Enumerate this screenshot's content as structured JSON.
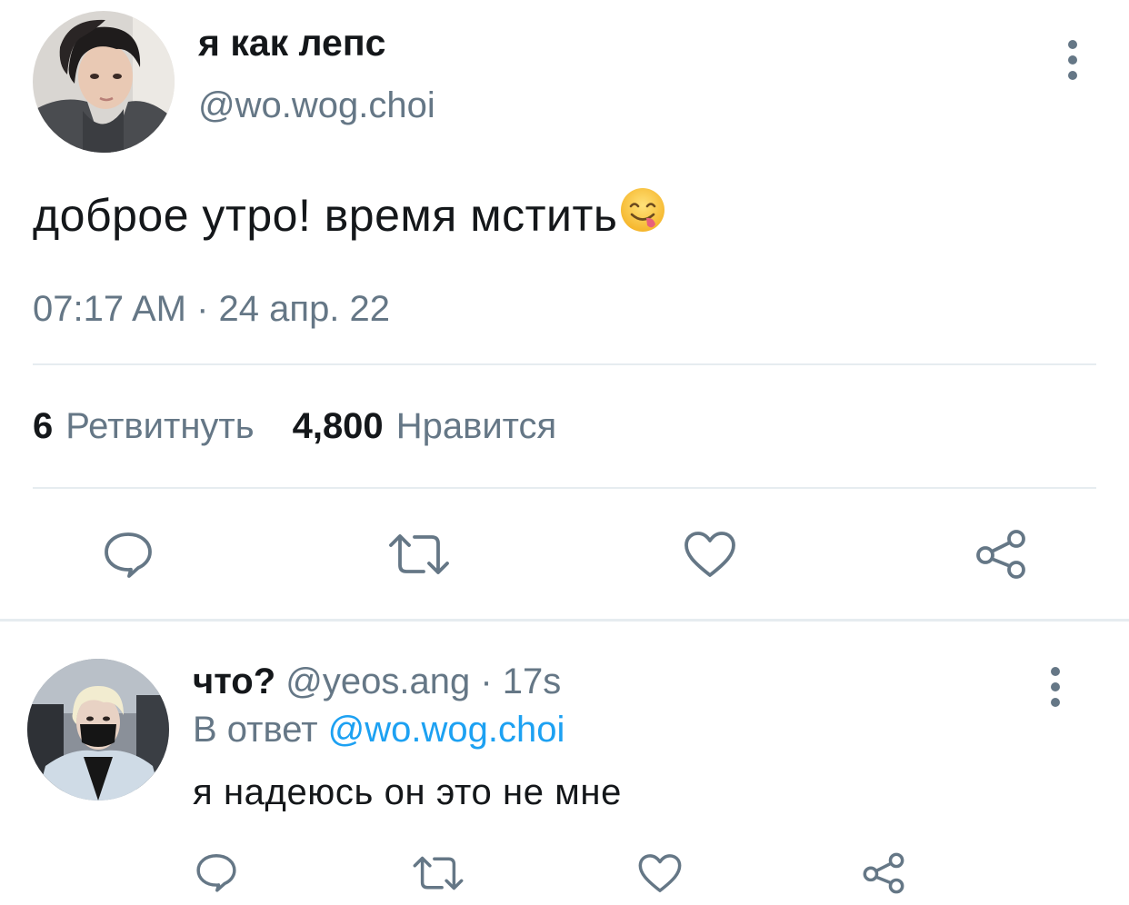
{
  "tweet": {
    "display_name": "я как лепс",
    "handle": "@wo.wog.choi",
    "text": "доброе утро! время мстить",
    "emoji_icon": "face-savoring-food-emoji",
    "timestamp": "07:17 AM · 24 апр. 22",
    "retweets_count": "6",
    "retweets_label": "Ретвитнуть",
    "likes_count": "4,800",
    "likes_label": "Нравится",
    "actions": [
      "reply-icon",
      "retweet-icon",
      "heart-icon",
      "share-icon"
    ]
  },
  "reply": {
    "display_name": "что?",
    "meta": "@yeos.ang · 17s",
    "reply_prefix": "В ответ",
    "reply_to_handle": "@wo.wog.choi",
    "text": "я надеюсь он это не мне",
    "actions": [
      "reply-icon",
      "retweet-icon",
      "heart-icon",
      "share-icon"
    ]
  },
  "colors": {
    "text_primary": "#14171a",
    "text_secondary": "#657786",
    "link": "#1da1f2",
    "divider": "#e6ecf0",
    "icon": "#657786"
  }
}
